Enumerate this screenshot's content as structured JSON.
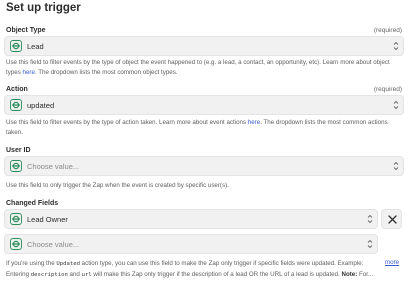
{
  "title": "Set up trigger",
  "object_type": {
    "label": "Object Type",
    "required": "(required)",
    "value": "Lead",
    "help_pre": "Use this field to filter events by the type of object the event happened to (e.g. a lead, a contact, an opportunity, etc). Learn more about object types ",
    "help_link": "here",
    "help_post": ". The dropdown lists the most common object types."
  },
  "action": {
    "label": "Action",
    "required": "(required)",
    "value": "updated",
    "help_pre": "Use this field to filter events by the type of action taken. Learn more about event actions ",
    "help_link": "here",
    "help_post": ". The dropdown lists the most common actions taken."
  },
  "user_id": {
    "label": "User ID",
    "placeholder": "Choose value...",
    "help": "Use this field to only trigger the Zap when the event is created by specific user(s)."
  },
  "changed_fields": {
    "label": "Changed Fields",
    "value": "Lead Owner",
    "placeholder": "Choose value...",
    "help_1": "If you're using the ",
    "help_code_1": "Updated",
    "help_2": " action type, you can use this field to make the Zap only trigger if specific fields were updated. Example:",
    "help_3": "Entering ",
    "help_code_2": "description",
    "help_4": " and ",
    "help_code_3": "url",
    "help_5": " will make this Zap only trigger if the description of a lead OR the URL of a lead is updated. ",
    "help_note": "Note:",
    "help_6": " For...",
    "more": "more"
  },
  "icons": {
    "field": "app-logo-icon",
    "chevron": "chevron-updown-icon",
    "remove": "close-icon"
  },
  "colors": {
    "link": "#3a5bd9",
    "field_bg": "#f1f1f1",
    "icon_green": "#2f8a5c"
  }
}
